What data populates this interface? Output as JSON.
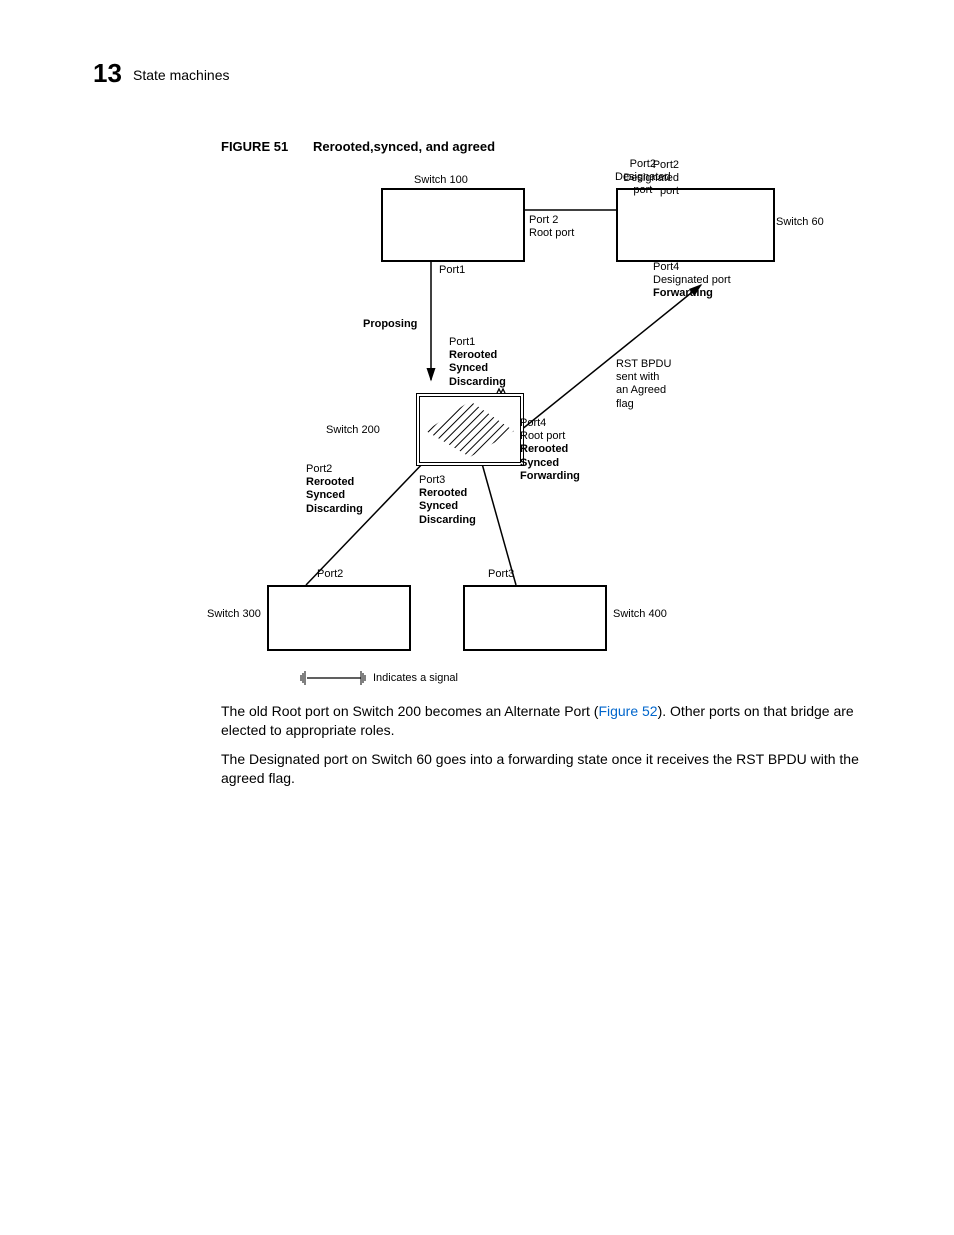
{
  "header": {
    "chapter_number": "13",
    "chapter_title": "State machines"
  },
  "figure": {
    "label": "FIGURE 51",
    "title": "Rerooted,synced, and agreed"
  },
  "diagram": {
    "switch100": "Switch 100",
    "switch60": "Switch 60",
    "switch200": "Switch 200",
    "switch300": "Switch 300",
    "switch400": "Switch 400",
    "port2_designated": "Port2\nDesignated\nport",
    "port2_root": "Port 2\nRoot port",
    "port1_top": "Port1",
    "proposing": "Proposing",
    "port4_desig_fwd": "Port4\nDesignated port\nForwarding",
    "port1_rerooted": "Port1\nRerooted\nSynced\nDiscarding",
    "rst_bpdu": "RST BPDU\nsent with\nan Agreed\nflag",
    "port4_root": "Port4\nRoot port\nRerooted\nSynced\nForwarding",
    "port2_rerooted": "Port2\nRerooted\nSynced\nDiscarding",
    "port3_rerooted": "Port3\nRerooted\nSynced\nDiscarding",
    "port2_b": "Port2",
    "port3_b": "Port3",
    "legend": "Indicates a signal"
  },
  "body": {
    "p1a": "The old Root port on Switch 200 becomes an Alternate Port (",
    "p1link": "Figure 52",
    "p1b": "). Other ports on that bridge are elected to appropriate roles.",
    "p2": "The Designated port on Switch 60 goes into a forwarding state once it receives the RST BPDU with the agreed flag."
  }
}
